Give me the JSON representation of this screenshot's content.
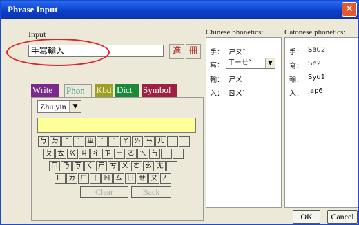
{
  "window": {
    "title": "Phrase Input",
    "close_glyph": "✕"
  },
  "input": {
    "label": "Input",
    "value": "手寫輸入"
  },
  "toolbar": {
    "icon1": "進",
    "icon2": "冊"
  },
  "tabs": [
    {
      "label": "Write",
      "color": "#7a2a8a"
    },
    {
      "label": "Phon",
      "color": "#1a9a9a"
    },
    {
      "label": "Kbd",
      "color": "#a0a020"
    },
    {
      "label": "Dict",
      "color": "#1a8a3a"
    },
    {
      "label": "Symbol",
      "color": "#a02040"
    }
  ],
  "phon": {
    "method": "Zhu yin"
  },
  "keyboard": {
    "row1": [
      "ㄅ",
      "ㄉ",
      "ˇ",
      "ˋ",
      "ㄓ",
      "ˊ",
      "˙",
      "ㄚ",
      "ㄞ",
      "ㄢ",
      "ㄦ",
      "",
      ""
    ],
    "row2": [
      "ㄆ",
      "ㄊ",
      "ㄍ",
      "ㄐ",
      "ㄔ",
      "ㄗ",
      "ㄧ",
      "ㄛ",
      "ㄟ",
      "ㄣ",
      "",
      ""
    ],
    "row3": [
      "ㄇ",
      "ㄋ",
      "ㄎ",
      "ㄑ",
      "ㄕ",
      "ㄘ",
      "ㄨ",
      "ㄜ",
      "ㄠ",
      "ㄤ",
      ""
    ],
    "row4": [
      "ㄈ",
      "ㄌ",
      "ㄏ",
      "ㄒ",
      "ㄖ",
      "ㄙ",
      "ㄩ",
      "ㄝ",
      "ㄡ",
      "ㄥ"
    ],
    "clear_label": "Clear",
    "back_label": "Back"
  },
  "chinese_phonetics": {
    "header": "Chinese phonetics:",
    "rows": [
      {
        "char": "手：",
        "phon": "ㄕㄡˇ"
      },
      {
        "char": "寫：",
        "phon": "ㄒㄧㄝˇ"
      },
      {
        "char": "輸：",
        "phon": "ㄕㄨ"
      },
      {
        "char": "入：",
        "phon": "ㄖㄨˋ"
      }
    ]
  },
  "cantonese_phonetics": {
    "header": "Catonese phonetics:",
    "rows": [
      {
        "char": "手：",
        "phon": "Sau2"
      },
      {
        "char": "寫：",
        "phon": "Se2"
      },
      {
        "char": "輸：",
        "phon": "Syu1"
      },
      {
        "char": "入：",
        "phon": "Jap6"
      }
    ]
  },
  "buttons": {
    "ok": "OK",
    "cancel": "Cancel"
  }
}
